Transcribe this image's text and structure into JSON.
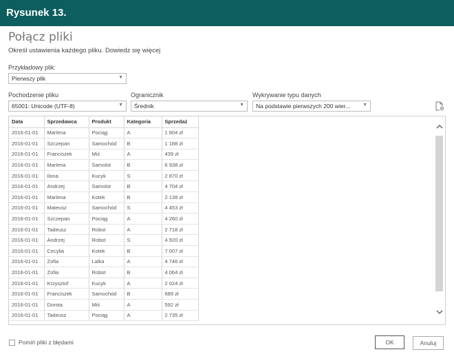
{
  "banner": {
    "title": "Rysunek 13."
  },
  "dialog": {
    "title": "Połącz pliki",
    "subtitle": "Określ ustawienia każdego pliku. Dowiedz się więcej"
  },
  "sample_file": {
    "label": "Przykładowy plik:",
    "value": "Pierwszy plik"
  },
  "file_origin": {
    "label": "Pochodzenie pliku",
    "value": "65001: Unicode (UTF-8)"
  },
  "delimiter": {
    "label": "Ogranicznik",
    "value": "Średnik"
  },
  "type_detection": {
    "label": "Wykrywanie typu danych",
    "value": "Na podstawie pierwszych 200 wier..."
  },
  "table": {
    "headers": [
      "Data",
      "Sprzedawca",
      "Produkt",
      "Kategoria",
      "Sprzedaż"
    ],
    "rows": [
      [
        "2016-01-01",
        "Marlena",
        "Pociąg",
        "A",
        "1 804 zł"
      ],
      [
        "2016-01-01",
        "Szczepan",
        "Samochód",
        "B",
        "1 188 zł"
      ],
      [
        "2016-01-01",
        "Franciszek",
        "Miś",
        "A",
        "439 zł"
      ],
      [
        "2016-01-01",
        "Marlena",
        "Samolot",
        "B",
        "6 938 zł"
      ],
      [
        "2016-01-01",
        "Ilona",
        "Kucyk",
        "S",
        "2 870 zł"
      ],
      [
        "2016-01-01",
        "Andrzej",
        "Samolot",
        "B",
        "4 704 zł"
      ],
      [
        "2016-01-01",
        "Marlena",
        "Kotek",
        "B",
        "2 138 zł"
      ],
      [
        "2016-01-01",
        "Mateusz",
        "Samochód",
        "S",
        "4 453 zł"
      ],
      [
        "2016-01-01",
        "Szczepan",
        "Pociąg",
        "A",
        "4 260 zł"
      ],
      [
        "2016-01-01",
        "Tadeusz",
        "Robot",
        "A",
        "2 718 zł"
      ],
      [
        "2016-01-01",
        "Andrzej",
        "Robot",
        "S",
        "4 920 zł"
      ],
      [
        "2016-01-01",
        "Cecylia",
        "Kotek",
        "B",
        "7 007 zł"
      ],
      [
        "2016-01-01",
        "Zofia",
        "Lalka",
        "A",
        "4 746 zł"
      ],
      [
        "2016-01-01",
        "Zofia",
        "Robot",
        "B",
        "4 064 zł"
      ],
      [
        "2016-01-01",
        "Krzysztof",
        "Kucyk",
        "A",
        "2 024 zł"
      ],
      [
        "2016-01-01",
        "Franciszek",
        "Samochód",
        "B",
        "689 zł"
      ],
      [
        "2016-01-01",
        "Dorota",
        "Miś",
        "A",
        "592 zł"
      ],
      [
        "2016-01-01",
        "Tadeusz",
        "Pociąg",
        "A",
        "2 735 zł"
      ]
    ]
  },
  "skip_errors": {
    "label": "Pomiń pliki z błędami",
    "checked": false
  },
  "buttons": {
    "ok": "OK",
    "cancel": "Anuluj"
  },
  "icons": {
    "dropdown": "chevron-down-icon",
    "file_settings": "document-settings-icon",
    "scroll_up": "chevron-up-icon",
    "scroll_down": "chevron-down-icon"
  },
  "colors": {
    "banner": "#0d5e5e",
    "banner_text": "#ffffff"
  }
}
